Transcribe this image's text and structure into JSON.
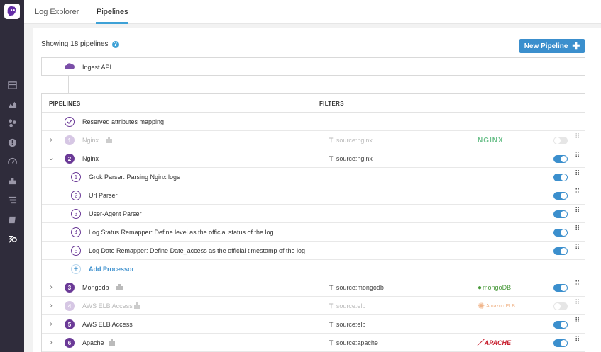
{
  "topbar": {
    "tabs": [
      {
        "label": "Log Explorer",
        "active": false
      },
      {
        "label": "Pipelines",
        "active": true
      }
    ]
  },
  "header": {
    "showing_text": "Showing 18 pipelines",
    "new_pipeline_label": "New Pipeline"
  },
  "ingest": {
    "label": "Ingest API"
  },
  "table": {
    "col_pipelines": "PIPELINES",
    "col_filters": "FILTERS",
    "reserved_label": "Reserved attributes mapping",
    "rows": [
      {
        "num": "1",
        "name": "Nginx",
        "filter": "source:nginx",
        "logo": "NGINX",
        "enabled": false,
        "expanded": false
      },
      {
        "num": "2",
        "name": "Nginx",
        "filter": "source:nginx",
        "enabled": true,
        "expanded": true
      },
      {
        "num": "3",
        "name": "Mongodb",
        "filter": "source:mongodb",
        "logo": "mongoDB",
        "enabled": true,
        "expanded": false
      },
      {
        "num": "4",
        "name": "AWS ELB Access",
        "filter": "source:elb",
        "logo": "Amazon ELB",
        "enabled": false,
        "expanded": false
      },
      {
        "num": "5",
        "name": "AWS ELB Access",
        "filter": "source:elb",
        "enabled": true,
        "expanded": false
      },
      {
        "num": "6",
        "name": "Apache",
        "filter": "source:apache",
        "logo": "APACHE",
        "enabled": true,
        "expanded": false
      }
    ],
    "processors": [
      {
        "num": "1",
        "name": "Grok Parser: Parsing Nginx logs",
        "enabled": true
      },
      {
        "num": "2",
        "name": "Url Parser",
        "enabled": true
      },
      {
        "num": "3",
        "name": "User-Agent Parser",
        "enabled": true
      },
      {
        "num": "4",
        "name": "Log Status Remapper: Define level as the official status of the log",
        "enabled": true
      },
      {
        "num": "5",
        "name": "Log Date Remapper: Define Date_access as the official timestamp of the log",
        "enabled": true
      }
    ],
    "add_processor_label": "Add Processor"
  },
  "colors": {
    "accent": "#3b8fcd",
    "purple": "#6b3a97",
    "sidebar": "#2f2c3b",
    "nginx": "#6cc08b",
    "mongo": "#4a9a3c",
    "apache": "#c8202f"
  }
}
